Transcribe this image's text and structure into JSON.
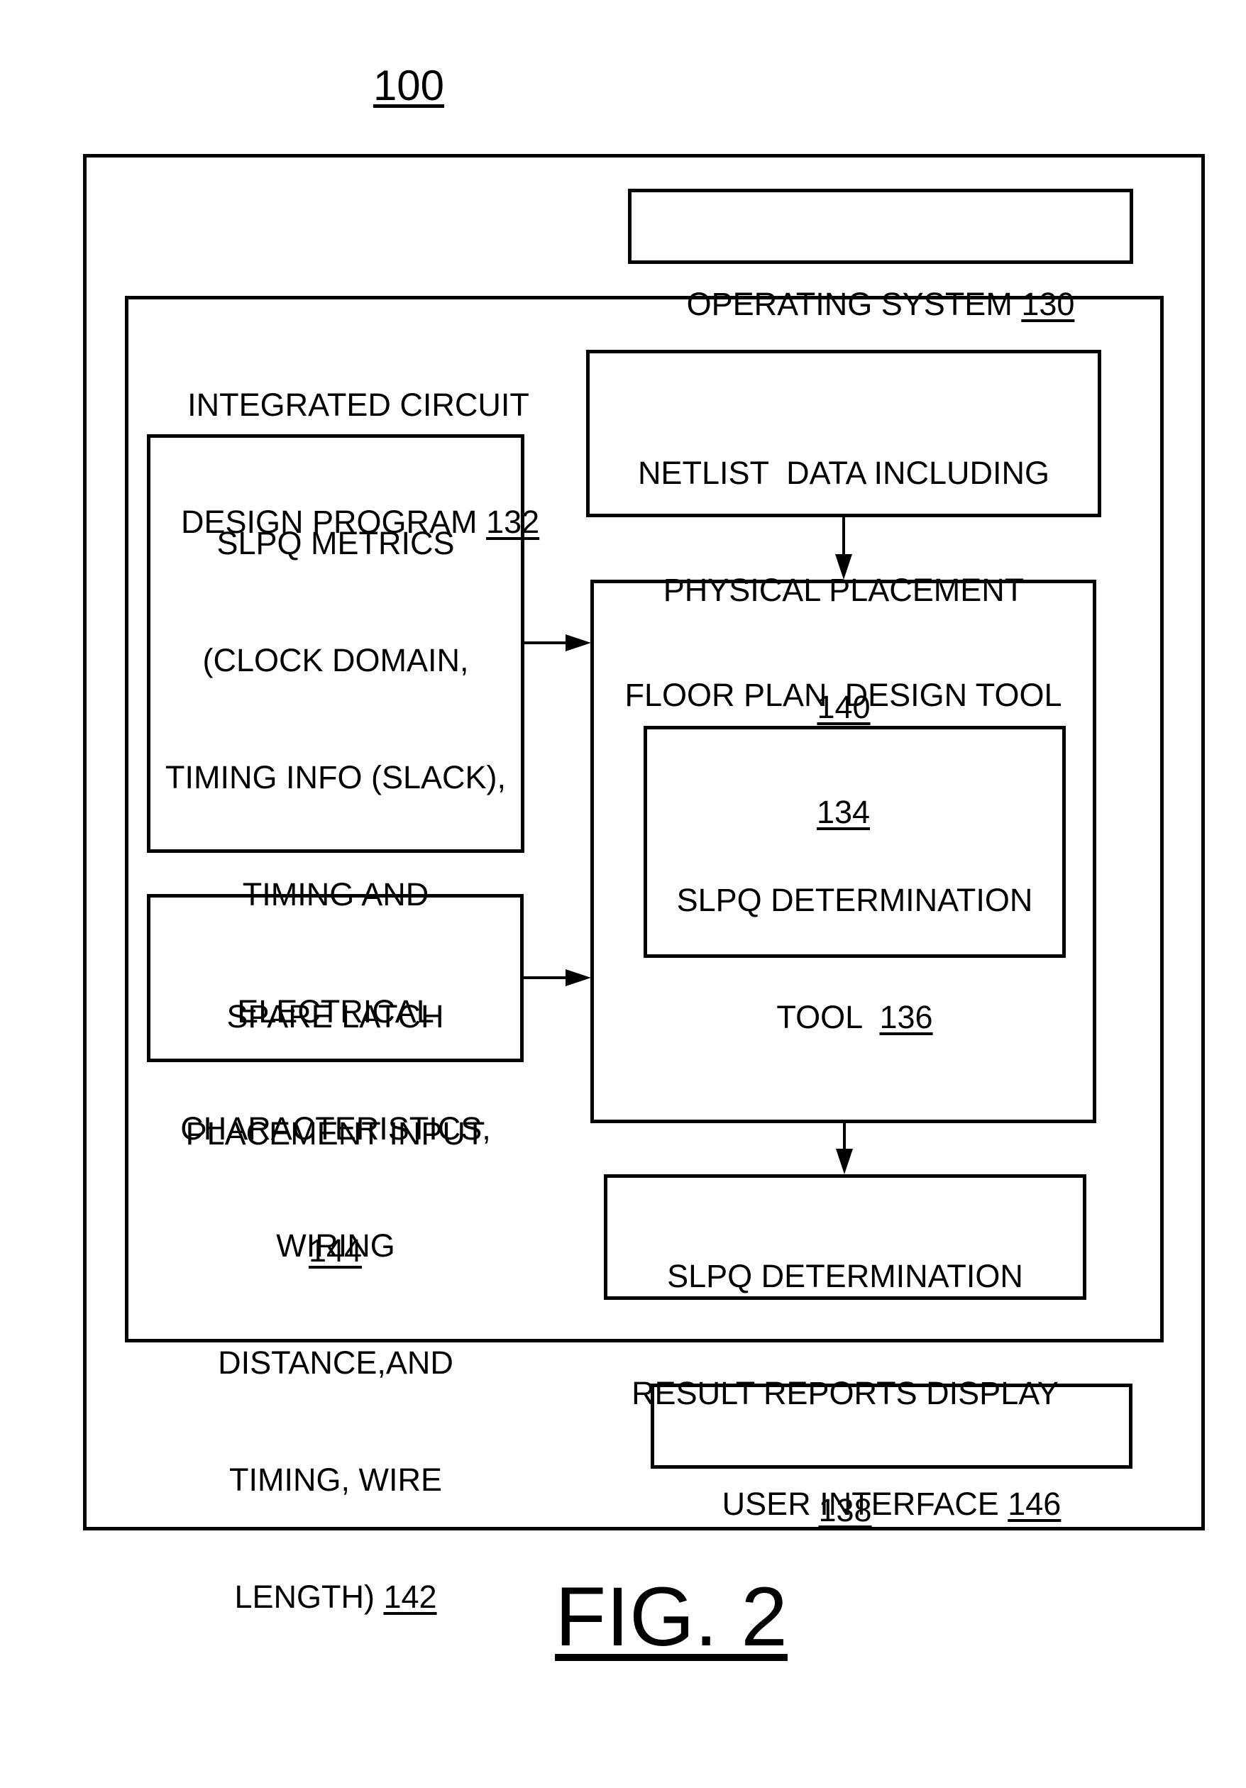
{
  "figure": {
    "reference_number": "100",
    "caption": "FIG. 2"
  },
  "colors": {
    "line": "#000000",
    "background": "#ffffff"
  },
  "blocks": {
    "operating_system": {
      "lines": [
        {
          "text": "OPERATING SYSTEM ",
          "ref": "130"
        }
      ]
    },
    "ic_design_program": {
      "lines": [
        {
          "text": "INTEGRATED CIRCUIT",
          "ref": ""
        },
        {
          "text": "DESIGN PROGRAM ",
          "ref": "132"
        }
      ]
    },
    "netlist_data": {
      "lines": [
        {
          "text": "NETLIST  DATA INCLUDING",
          "ref": ""
        },
        {
          "text": "PHYSICAL PLACEMENT",
          "ref": ""
        },
        {
          "text": "",
          "ref": "140"
        }
      ]
    },
    "slpq_metrics": {
      "lines": [
        {
          "text": "SLPQ METRICS",
          "ref": ""
        },
        {
          "text": "(CLOCK DOMAIN,",
          "ref": ""
        },
        {
          "text": "TIMING INFO (SLACK),",
          "ref": ""
        },
        {
          "text": "TIMING AND",
          "ref": ""
        },
        {
          "text": "ELECTRICAL",
          "ref": ""
        },
        {
          "text": "CHARACTERISTICS,",
          "ref": ""
        },
        {
          "text": "WIRING",
          "ref": ""
        },
        {
          "text": "DISTANCE,AND",
          "ref": ""
        },
        {
          "text": "TIMING, WIRE",
          "ref": ""
        },
        {
          "text": "LENGTH) ",
          "ref": "142"
        }
      ]
    },
    "floor_plan_tool": {
      "lines": [
        {
          "text": "FLOOR PLAN  DESIGN TOOL",
          "ref": ""
        },
        {
          "text": "",
          "ref": "134"
        }
      ]
    },
    "slpq_determination_tool": {
      "lines": [
        {
          "text": "SLPQ DETERMINATION",
          "ref": ""
        },
        {
          "text": "TOOL  ",
          "ref": "136"
        }
      ]
    },
    "spare_latch_input": {
      "lines": [
        {
          "text": "SPARE LATCH",
          "ref": ""
        },
        {
          "text": "PLACEMENT INPUT",
          "ref": ""
        },
        {
          "text": "",
          "ref": "144"
        }
      ]
    },
    "result_reports_display": {
      "lines": [
        {
          "text": "SLPQ DETERMINATION",
          "ref": ""
        },
        {
          "text": "RESULT REPORTS DISPLAY",
          "ref": ""
        },
        {
          "text": "",
          "ref": "138"
        }
      ]
    },
    "user_interface": {
      "lines": [
        {
          "text": "USER INTERFACE ",
          "ref": "146"
        }
      ]
    }
  },
  "connections": [
    {
      "from": "netlist_data",
      "to": "floor_plan_tool",
      "direction": "down"
    },
    {
      "from": "slpq_metrics",
      "to": "floor_plan_tool",
      "direction": "right"
    },
    {
      "from": "spare_latch_input",
      "to": "floor_plan_tool",
      "direction": "right"
    },
    {
      "from": "floor_plan_tool",
      "to": "result_reports_display",
      "direction": "down"
    }
  ]
}
